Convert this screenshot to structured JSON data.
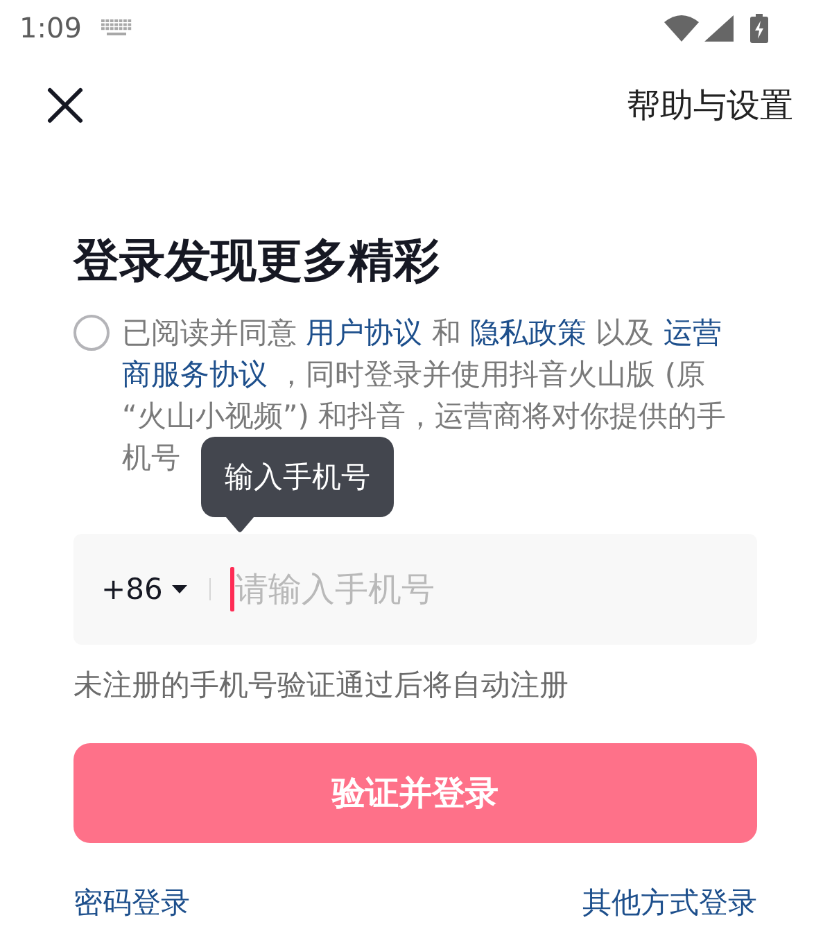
{
  "status_bar": {
    "time": "1:09"
  },
  "header": {
    "help_link": "帮助与设置"
  },
  "title": "登录发现更多精彩",
  "agreement": {
    "checked": false,
    "lines": [
      [
        {
          "kind": "text",
          "text": "已阅读并同意 "
        },
        {
          "kind": "link",
          "text": "用户协议"
        },
        {
          "kind": "text",
          "text": " 和 "
        },
        {
          "kind": "link",
          "text": "隐私政策"
        },
        {
          "kind": "text",
          "text": " 以及 "
        },
        {
          "kind": "link",
          "text": "运营"
        }
      ],
      [
        {
          "kind": "link",
          "text": "商服务协议"
        },
        {
          "kind": "text",
          "text": " ，同时登录并使用抖音火山版 (原"
        }
      ],
      [
        {
          "kind": "text",
          "text": "“火山小视频”) 和抖音，运营商将对你提供的手"
        }
      ],
      [
        {
          "kind": "text",
          "text": "机号"
        }
      ]
    ]
  },
  "tooltip": "输入手机号",
  "phone_field": {
    "country_code": "+86",
    "placeholder": "请输入手机号"
  },
  "hint": "未注册的手机号验证通过后将自动注册",
  "submit_button": {
    "label": "验证并登录",
    "disabled": true
  },
  "footer_links": [
    "密码登录",
    "其他方式登录"
  ]
}
